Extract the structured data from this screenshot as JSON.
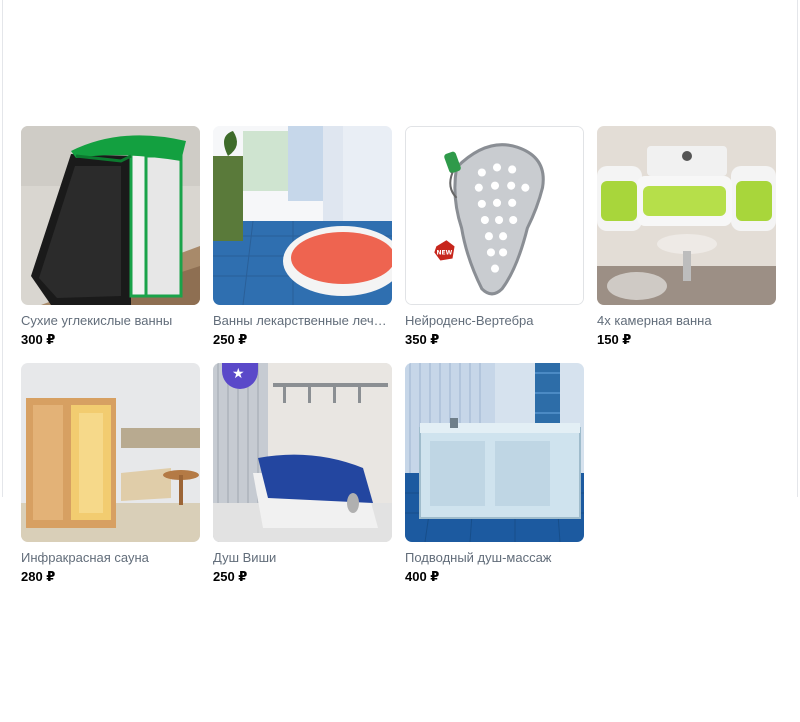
{
  "products": [
    {
      "name": "Сухие углекислые ванны",
      "price": "300 ₽",
      "image": "dry-co2-bath-photo"
    },
    {
      "name": "Ванны лекарственные лече…",
      "price": "250 ₽",
      "image": "medicinal-bath-photo"
    },
    {
      "name": "Нейроденс-Вертебра",
      "price": "350 ₽",
      "image": "neurodens-vertebra-device-photo",
      "image_badge": "NEW"
    },
    {
      "name": "4х камерная ванна",
      "price": "150 ₽",
      "image": "four-chamber-bath-photo"
    },
    {
      "name": "Инфракрасная сауна",
      "price": "280 ₽",
      "image": "infrared-sauna-photo"
    },
    {
      "name": "Душ Виши",
      "price": "250 ₽",
      "image": "vichy-shower-photo"
    },
    {
      "name": "Подводный душ-массаж",
      "price": "400 ₽",
      "image": "underwater-massage-shower-photo"
    }
  ]
}
